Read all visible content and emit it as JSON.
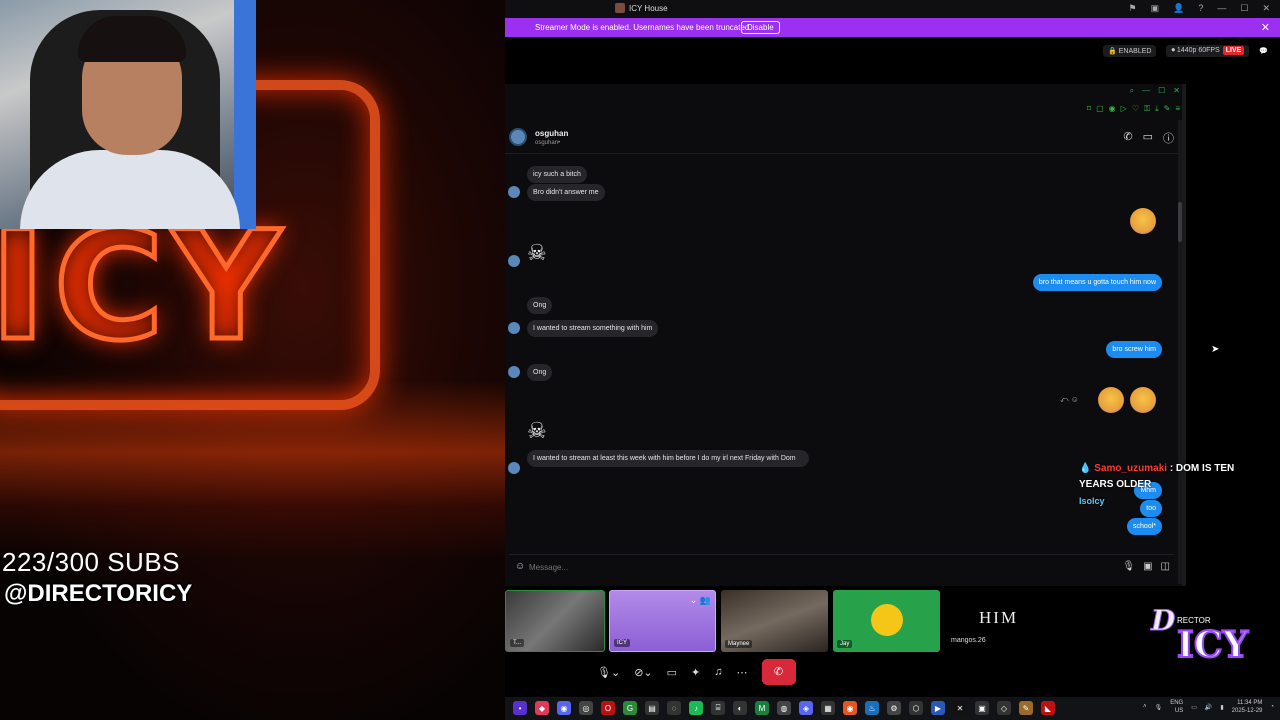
{
  "overlay": {
    "subs_counter": "223/300 SUBS",
    "handle": "@DIRECTORICY"
  },
  "window": {
    "title": "ICY House",
    "controls": [
      "⚑",
      "▣",
      "👤",
      "?",
      "—",
      "☐",
      "✕"
    ]
  },
  "banner": {
    "text": "Streamer Mode is enabled. Usernames have been truncated.",
    "disable_label": "Disable",
    "close": "✕"
  },
  "stream_status": {
    "enabled_label": "ENABLED",
    "quality": "1440p 60FPS",
    "live": "LIVE"
  },
  "dm": {
    "name": "osguhan",
    "username": "osguhan•",
    "composer_placeholder": "Message...",
    "messages_left": [
      {
        "text": "icy such a bitch"
      },
      {
        "text": "Bro didn't answer me"
      },
      {
        "text": "Ong"
      },
      {
        "text": "I wanted to stream something with him"
      },
      {
        "text": "Ong"
      },
      {
        "text": "I wanted to stream at least this week with him before I do my irl next Friday with Dom"
      }
    ],
    "messages_right": [
      {
        "text": "bro that means u gotta touch him now"
      },
      {
        "text": "bro screw him"
      },
      {
        "text": "Mhm"
      },
      {
        "text": "too"
      },
      {
        "text": "school*"
      }
    ]
  },
  "chat_overlay": {
    "user": "Samo_uzumaki",
    "message": ": DOM IS TEN YEARS OLDER",
    "second_user": "Isolcy"
  },
  "call": {
    "tiles": [
      {
        "label": "T..."
      },
      {
        "label": "ICY"
      },
      {
        "label": "Maynee"
      },
      {
        "label": "Jay"
      }
    ],
    "him_label": "HIM",
    "mangos_label": "mangos.26"
  },
  "brand": {
    "line1": "D",
    "line2": "ICY",
    "line3": "RECTOR"
  },
  "taskbar": {
    "lang_top": "ENG",
    "lang_bottom": "US",
    "time": "11:34 PM",
    "date": "2025-12-29"
  }
}
